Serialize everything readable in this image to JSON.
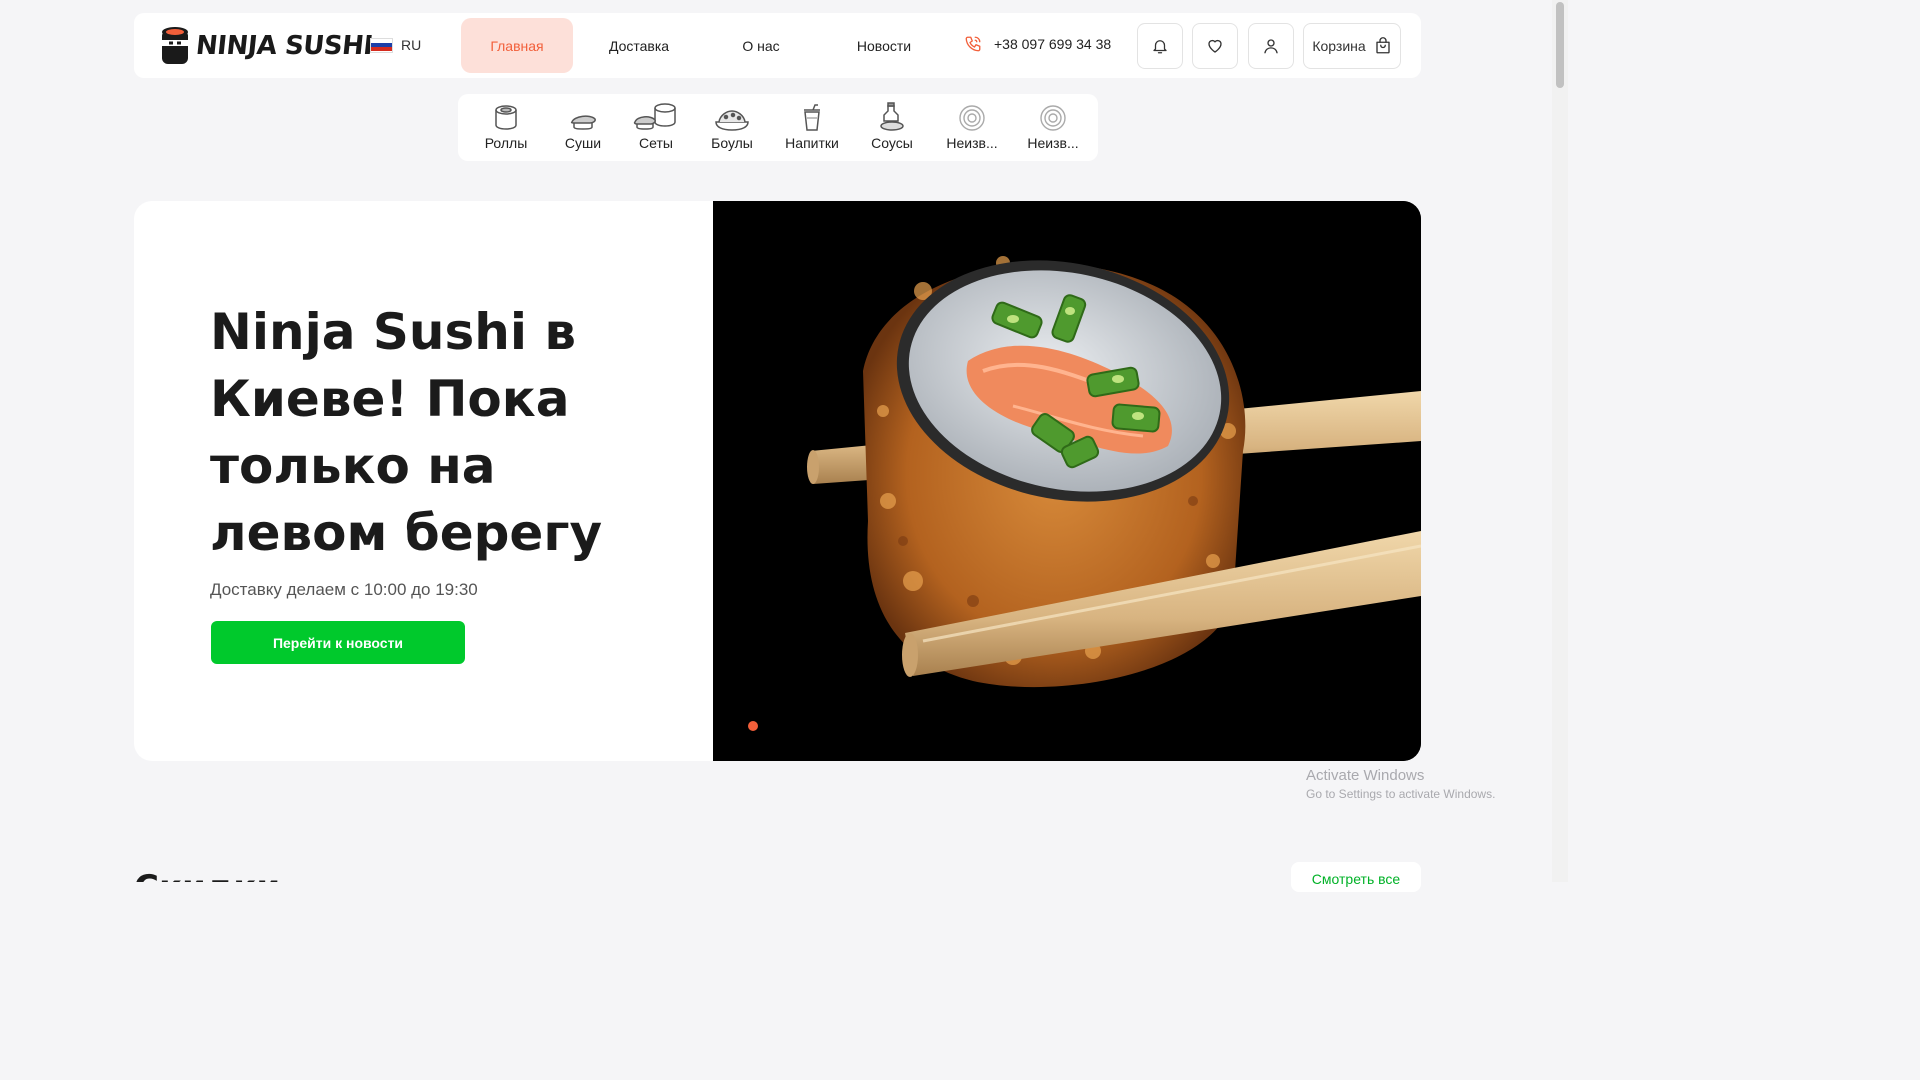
{
  "header": {
    "logo_text": "NINJA SUSHI",
    "language": "RU",
    "nav": [
      {
        "label": "Главная",
        "active": true
      },
      {
        "label": "Доставка",
        "active": false
      },
      {
        "label": "О нас",
        "active": false
      },
      {
        "label": "Новости",
        "active": false
      }
    ],
    "phone": "+38 097 699 34 38",
    "icons": [
      "bell-icon",
      "heart-icon",
      "user-icon"
    ],
    "cart_label": "Корзина"
  },
  "categories": [
    {
      "label": "Роллы",
      "icon": "roll-icon"
    },
    {
      "label": "Суши",
      "icon": "sushi-icon"
    },
    {
      "label": "Сеты",
      "icon": "set-icon"
    },
    {
      "label": "Боулы",
      "icon": "bowl-icon"
    },
    {
      "label": "Напитки",
      "icon": "drink-icon"
    },
    {
      "label": "Соусы",
      "icon": "sauce-icon"
    },
    {
      "label": "Неизв...",
      "icon": "unknown-icon"
    },
    {
      "label": "Неизв...",
      "icon": "unknown-icon"
    }
  ],
  "hero": {
    "title": "Ninja Sushi в Киеве! Пока только на левом берегу",
    "subtitle": "Доставку делаем с 10:00 до 19:30",
    "button_label": "Перейти к новости",
    "slides": 1,
    "active_slide": 1
  },
  "below": {
    "section_title": "Скидки",
    "see_all": "Смотреть все"
  },
  "watermark": {
    "title": "Activate Windows",
    "subtitle": "Go to Settings to activate Windows."
  },
  "colors": {
    "accent": "#f25f3a",
    "accent_bg": "#fde0d9",
    "cta": "#00c92c",
    "page_bg": "#f5f5f7"
  }
}
